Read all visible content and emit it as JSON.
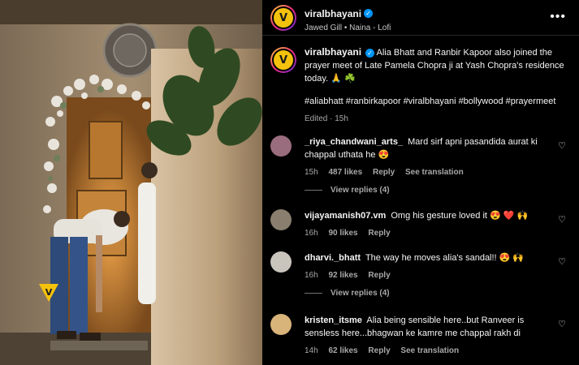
{
  "post": {
    "author": "viralbhayani",
    "music": "Jawed Gill • Naina - Lofi",
    "caption_text": "Alia Bhatt and Ranbir Kapoor also joined the prayer meet of Late Pamela Chopra ji at Yash Chopra's residence today. 🙏 ☘️",
    "hashtags": "#aliabhatt #ranbirkapoor #viralbhayani #bollywood #prayermeet",
    "edited": "Edited · 15h",
    "more_icon": "more-options-icon",
    "logo_letter": "V",
    "watermark_letter": "V"
  },
  "comments": [
    {
      "user": "_riya_chandwani_arts_",
      "text": "Mard sirf apni pasandida aurat ki chappal uthata he 😍",
      "age": "15h",
      "likes": "487 likes",
      "reply": "Reply",
      "translate": "See translation",
      "view_replies": "View replies (4)"
    },
    {
      "user": "vijayamanish07.vm",
      "text": "Omg his gesture loved it 😍 ❤️ 🙌",
      "age": "16h",
      "likes": "90 likes",
      "reply": "Reply"
    },
    {
      "user": "dharvi._bhatt",
      "text": "The way he moves alia's sandal!! 😍 🙌",
      "age": "16h",
      "likes": "92 likes",
      "reply": "Reply",
      "view_replies": "View replies (4)"
    },
    {
      "user": "kristen_itsme",
      "text": "Alia being sensible here..but Ranveer is sensless here...bhagwan ke kamre me chappal rakh di",
      "age": "14h",
      "likes": "62 likes",
      "reply": "Reply",
      "translate": "See translation"
    }
  ],
  "colors": {
    "accent_verified": "#0095f6",
    "brand_logo": "#f4c20d"
  }
}
